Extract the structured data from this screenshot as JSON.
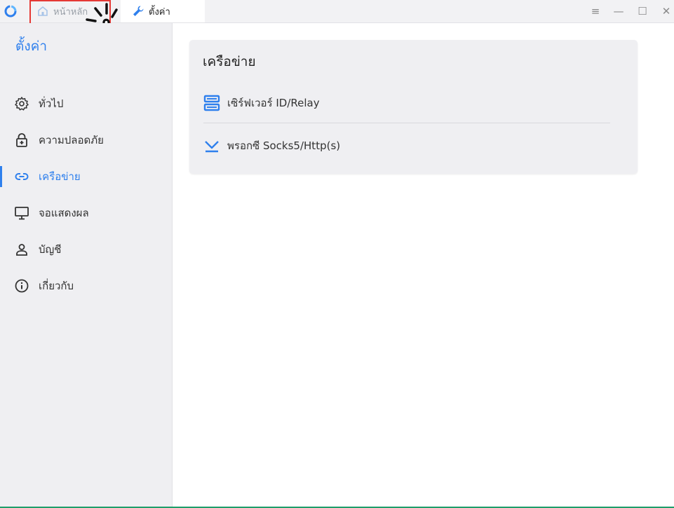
{
  "titlebar": {
    "tabs": [
      {
        "label": "หน้าหลัก",
        "icon": "home-icon"
      },
      {
        "label": "ตั้งค่า",
        "icon": "wrench-icon"
      }
    ],
    "controls": {
      "menu": "≡",
      "minimize": "—",
      "maximize": "☐",
      "close": "✕"
    }
  },
  "sidebar": {
    "title": "ตั้งค่า",
    "items": [
      {
        "label": "ทั่วไป",
        "icon": "gear-icon"
      },
      {
        "label": "ความปลอดภัย",
        "icon": "lock-icon"
      },
      {
        "label": "เครือข่าย",
        "icon": "link-icon"
      },
      {
        "label": "จอแสดงผล",
        "icon": "monitor-icon"
      },
      {
        "label": "บัญชี",
        "icon": "user-icon"
      },
      {
        "label": "เกี่ยวกับ",
        "icon": "info-icon"
      }
    ],
    "active_index": 2
  },
  "main": {
    "card_title": "เครือข่าย",
    "rows": [
      {
        "label": "เซิร์ฟเวอร์ ID/Relay",
        "icon": "server-icon"
      },
      {
        "label": "พรอกซี Socks5/Http(s)",
        "icon": "proxy-icon"
      }
    ]
  },
  "colors": {
    "accent": "#2f80ed",
    "highlight": "#e53935",
    "sidebar_bg": "#efeff2"
  }
}
